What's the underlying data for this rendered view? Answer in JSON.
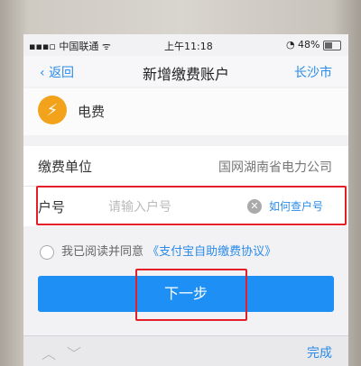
{
  "status_bar": {
    "carrier": "中国联通",
    "time": "上午11:18",
    "battery": "48%"
  },
  "nav": {
    "back_label": "返回",
    "title": "新增缴费账户",
    "city": "长沙市"
  },
  "bill": {
    "type_label": "电费"
  },
  "form": {
    "unit_label": "缴费单位",
    "unit_value": "国网湖南省电力公司",
    "account_label": "户号",
    "account_placeholder": "请输入户号",
    "how_to_find": "如何查户号"
  },
  "agreement": {
    "text": "我已阅读并同意",
    "link": "《支付宝自助缴费协议》"
  },
  "next_button": "下一步",
  "keyboard_bar": {
    "done": "完成"
  },
  "colors": {
    "accent": "#1e90f5",
    "highlight_box": "#e3202a",
    "bill_icon": "#f3a21c"
  }
}
